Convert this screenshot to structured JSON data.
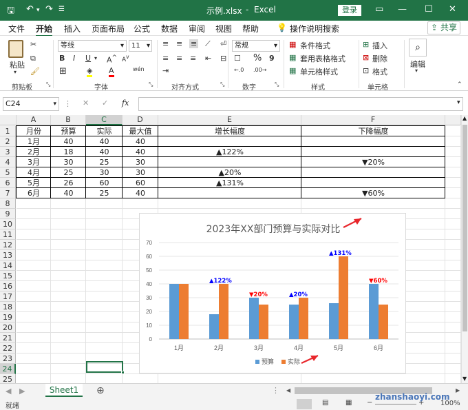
{
  "titlebar": {
    "filename": "示例.xlsx",
    "separator": "-",
    "app": "Excel",
    "login": "登录"
  },
  "menu": [
    "文件",
    "开始",
    "插入",
    "页面布局",
    "公式",
    "数据",
    "审阅",
    "视图",
    "帮助"
  ],
  "tell_me": "操作说明搜索",
  "share": "共享",
  "ribbon": {
    "paste": "粘贴",
    "font_name": "等线",
    "font_size": "11",
    "number_format": "常规",
    "conditional_formatting": "条件格式",
    "format_as_table": "套用表格格式",
    "cell_styles": "单元格样式",
    "insert": "插入",
    "delete": "删除",
    "format": "格式",
    "edit": "编辑",
    "groups": {
      "clipboard": "剪贴板",
      "font": "字体",
      "alignment": "对齐方式",
      "number": "数字",
      "styles": "样式",
      "cells": "单元格"
    }
  },
  "formula_bar": {
    "name_box": "C24",
    "fx": "fx",
    "formula": ""
  },
  "columns": [
    "A",
    "B",
    "C",
    "D",
    "E",
    "F"
  ],
  "rows": [
    "1",
    "2",
    "3",
    "4",
    "5",
    "6",
    "7",
    "8",
    "9",
    "10",
    "11",
    "12",
    "13",
    "14",
    "15",
    "16",
    "17",
    "18",
    "19",
    "20",
    "21",
    "22",
    "23",
    "24",
    "25"
  ],
  "table": {
    "headers": [
      "月份",
      "预算",
      "实际",
      "最大值",
      "增长幅度",
      "下降幅度"
    ],
    "rows": [
      [
        "1月",
        "40",
        "40",
        "40",
        "",
        ""
      ],
      [
        "2月",
        "18",
        "40",
        "40",
        "▲122%",
        ""
      ],
      [
        "3月",
        "30",
        "25",
        "30",
        "",
        "▼20%"
      ],
      [
        "4月",
        "25",
        "30",
        "30",
        "▲20%",
        ""
      ],
      [
        "5月",
        "26",
        "60",
        "60",
        "▲131%",
        ""
      ],
      [
        "6月",
        "40",
        "25",
        "40",
        "",
        "▼60%"
      ]
    ]
  },
  "chart_data": {
    "type": "bar",
    "title": "2023年XX部门预算与实际对比",
    "categories": [
      "1月",
      "2月",
      "3月",
      "4月",
      "5月",
      "6月"
    ],
    "series": [
      {
        "name": "预算",
        "values": [
          40,
          18,
          30,
          25,
          26,
          40
        ],
        "color": "#5b9bd5"
      },
      {
        "name": "实际",
        "values": [
          40,
          40,
          25,
          30,
          60,
          25
        ],
        "color": "#ed7d31"
      }
    ],
    "annotations": [
      {
        "category": "2月",
        "text": "▲122%",
        "color": "#0000ff",
        "at": 40
      },
      {
        "category": "3月",
        "text": "▼20%",
        "color": "#ff0000",
        "at": 30
      },
      {
        "category": "4月",
        "text": "▲20%",
        "color": "#0000ff",
        "at": 30
      },
      {
        "category": "5月",
        "text": "▲131%",
        "color": "#0000ff",
        "at": 60
      },
      {
        "category": "6月",
        "text": "▼60%",
        "color": "#ff0000",
        "at": 40
      }
    ],
    "ylim": [
      0,
      70
    ],
    "yticks": [
      0,
      10,
      20,
      30,
      40,
      50,
      60,
      70
    ],
    "grid": true,
    "legend": "bottom",
    "arrow_color": "#e8262b"
  },
  "sheet_tab": "Sheet1",
  "status": {
    "ready": "就绪",
    "zoom": "100%",
    "watermark": "zhanshaoyi.com"
  }
}
